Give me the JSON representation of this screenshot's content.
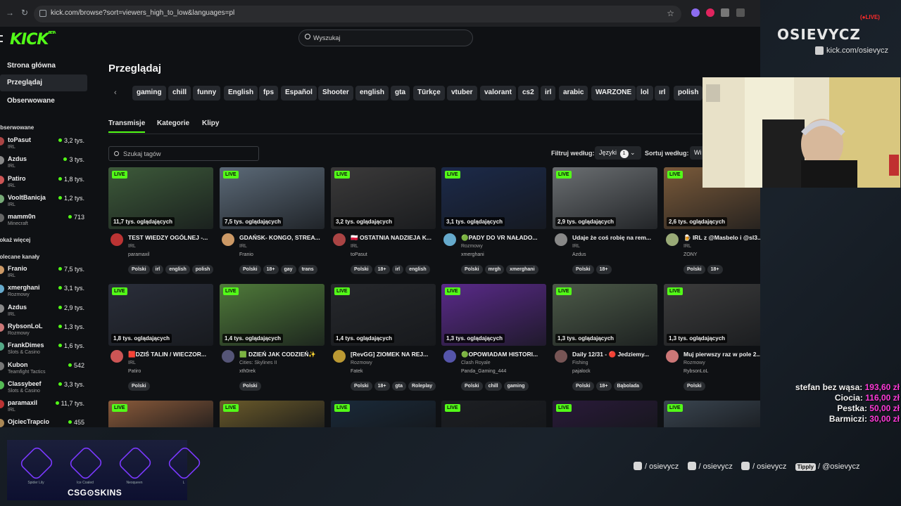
{
  "browser": {
    "url": "kick.com/browse?sort=viewers_high_to_low&languages=pl"
  },
  "kick": {
    "logo": "KICK",
    "logo_sup": "BETA",
    "search_placeholder": "Wyszukaj",
    "nav": [
      "Strona główna",
      "Przeglądaj",
      "Obserwowane"
    ],
    "followed_header": "Obserwowane",
    "followed": [
      {
        "name": "toPasut",
        "category": "IRL",
        "viewers": "3,2 tys.",
        "color": "#a44"
      },
      {
        "name": "Azdus",
        "category": "IRL",
        "viewers": "3 tys.",
        "color": "#888"
      },
      {
        "name": "Patiro",
        "category": "IRL",
        "viewers": "1,8 tys.",
        "color": "#c55"
      },
      {
        "name": "VooltBanicja",
        "category": "IRL",
        "viewers": "1,2 tys.",
        "color": "#7a7"
      },
      {
        "name": "mamm0n",
        "category": "Minecraft",
        "viewers": "713",
        "color": "#666"
      }
    ],
    "show_more": "Pokaż więcej",
    "recommended_header": "Polecane kanały",
    "recommended": [
      {
        "name": "Franio",
        "category": "IRL",
        "viewers": "7,5 tys.",
        "color": "#c96"
      },
      {
        "name": "xmerghani",
        "category": "Rozmowy",
        "viewers": "3,1 tys.",
        "color": "#6ac"
      },
      {
        "name": "Azdus",
        "category": "IRL",
        "viewers": "2,9 tys.",
        "color": "#888"
      },
      {
        "name": "RybsonLoL",
        "category": "Rozmowy",
        "viewers": "1,3 tys.",
        "color": "#c77"
      },
      {
        "name": "FrankDimes",
        "category": "Slots & Casino",
        "viewers": "1,6 tys.",
        "color": "#5a8"
      },
      {
        "name": "Kubon",
        "category": "Teamfight Tactics",
        "viewers": "542",
        "color": "#777"
      },
      {
        "name": "Classybeef",
        "category": "Slots & Casino",
        "viewers": "3,3 tys.",
        "color": "#5b5"
      },
      {
        "name": "paramaxil",
        "category": "IRL",
        "viewers": "11,7 tys.",
        "color": "#b33"
      },
      {
        "name": "OjciecTrapcio",
        "category": "",
        "viewers": "455",
        "color": "#a85"
      }
    ],
    "page_title": "Przeglądaj",
    "chips": [
      "gaming",
      "chill",
      "funny",
      "English",
      "fps",
      "Español",
      "Shooter",
      "english",
      "gta",
      "Türkçe",
      "vtuber",
      "valorant",
      "cs2",
      "irl",
      "arabic",
      "WARZONE",
      "lol",
      "ırl",
      "polish"
    ],
    "tabs": [
      "Transmisje",
      "Kategorie",
      "Klipy"
    ],
    "tag_search_placeholder": "Szukaj tagów",
    "filter_label": "Filtruj według:",
    "languages_label": "Języki",
    "languages_count": "1",
    "sort_label": "Sortuj według:",
    "sort_value": "Wi",
    "live_label": "LIVE",
    "cards": [
      {
        "viewers": "11,7 tys. oglądających",
        "title": "TEST WIEDZY OGÓLNEJ -...",
        "category": "IRL",
        "channel": "paramaxil",
        "tags": [
          "Polski",
          "irl",
          "english",
          "polish"
        ],
        "thumb": "#3d5a3a",
        "avatar": "#b33"
      },
      {
        "viewers": "7,5 tys. oglądających",
        "title": "GDAŃSK- KONGO, STREA...",
        "category": "IRL",
        "channel": "Franio",
        "tags": [
          "Polski",
          "18+",
          "gay",
          "trans"
        ],
        "thumb": "#5c6a78",
        "avatar": "#c96"
      },
      {
        "viewers": "3,2 tys. oglądających",
        "title": "🇵🇱 OSTATNIA NADZIEJA K...",
        "category": "IRL",
        "channel": "toPasut",
        "tags": [
          "Polski",
          "18+",
          "irl",
          "english"
        ],
        "thumb": "#3b3a3a",
        "avatar": "#a44"
      },
      {
        "viewers": "3,1 tys. oglądających",
        "title": "🟢PADY DO VR NAŁADO...",
        "category": "Rozmowy",
        "channel": "xmerghani",
        "tags": [
          "Polski",
          "mrgh",
          "xmerghani"
        ],
        "thumb": "#1c2a4a",
        "avatar": "#6ac"
      },
      {
        "viewers": "2,9 tys. oglądających",
        "title": "Udaje że coś robię na rem...",
        "category": "IRL",
        "channel": "Azdus",
        "tags": [
          "Polski",
          "18+"
        ],
        "thumb": "#6b6f72",
        "avatar": "#888"
      },
      {
        "viewers": "2,6 tys. oglądających",
        "title": "🍺 IRL z @Masbelo i @sl3...",
        "category": "IRL",
        "channel": "ZONY",
        "tags": [
          "Polski",
          "18+"
        ],
        "thumb": "#7a5a3a",
        "avatar": "#9a7"
      },
      {
        "viewers": "1,8 tys. oglądających",
        "title": "🟥DZIŚ TALIN / WIECZOR...",
        "category": "IRL",
        "channel": "Patiro",
        "tags": [
          "Polski"
        ],
        "thumb": "#2a2e3a",
        "avatar": "#c55"
      },
      {
        "viewers": "1,4 tys. oglądających",
        "title": "🟩 DZIEŃ JAK CODZIEŃ✨",
        "category": "Cities: Skylines II",
        "channel": "xth0rek",
        "tags": [
          "Polski"
        ],
        "thumb": "#4f7a3a",
        "avatar": "#557"
      },
      {
        "viewers": "1,4 tys. oglądających",
        "title": "[RevGG] ZIOMEK NA REJ...",
        "category": "Rozmowy",
        "channel": "Fatek",
        "tags": [
          "Polski",
          "18+",
          "gta",
          "Roleplay"
        ],
        "thumb": "#26282c",
        "avatar": "#b93"
      },
      {
        "viewers": "1,3 tys. oglądających",
        "title": "🟢OPOWIADAM HISTORI...",
        "category": "Clash Royale",
        "channel": "Panda_Gaming_444",
        "tags": [
          "Polski",
          "chill",
          "gaming"
        ],
        "thumb": "#5a2a8a",
        "avatar": "#55a"
      },
      {
        "viewers": "1,3 tys. oglądających",
        "title": "Daily 12/31 - 🔴 Jedziemy...",
        "category": "Fishing",
        "channel": "pajalock",
        "tags": [
          "Polski",
          "18+",
          "Bąbolada"
        ],
        "thumb": "#4c5a48",
        "avatar": "#755"
      },
      {
        "viewers": "1,3 tys. oglądających",
        "title": "Muj pierwszy raz w pole 2...",
        "category": "Rozmowy",
        "channel": "RybsonLoL",
        "tags": [
          "Polski"
        ],
        "thumb": "#3c3c3c",
        "avatar": "#c77"
      }
    ],
    "row3_thumbs": [
      "#8a5a3a",
      "#6a5a2a",
      "#1a2a3a",
      "#1d1f23",
      "#2a1a3a",
      "#3a4550"
    ]
  },
  "overlay": {
    "brand": "OSIEVYCZ",
    "live": "(●LIVE)",
    "kick_url": "kick.com/osievycz",
    "donations": [
      {
        "name": "stefan bez wąsa:",
        "amount": "193,60 zł"
      },
      {
        "name": "Ciocia:",
        "amount": "116,00 zł"
      },
      {
        "name": "Pestka:",
        "amount": "50,00 zł"
      },
      {
        "name": "Barmiczi:",
        "amount": "30,00 zł"
      }
    ],
    "socials": [
      "/ osievycz",
      "/ osievycz",
      "/ osievycz",
      "/ @osievycz"
    ],
    "tipply": "Tipply",
    "sponsor": "CSG⊙SKINS",
    "skins": [
      "Spider Lily",
      "Ice Coaled",
      "Neoqueen",
      "L"
    ]
  }
}
